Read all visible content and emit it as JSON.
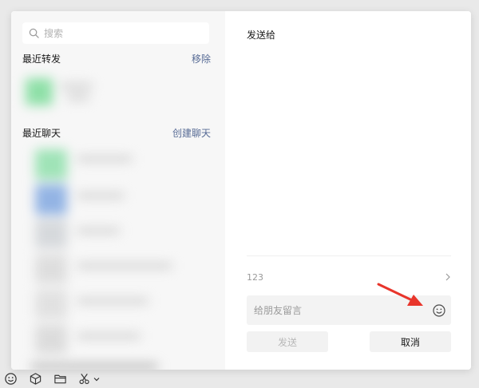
{
  "search": {
    "placeholder": "搜索"
  },
  "recent_forward": {
    "title": "最近转发",
    "action": "移除"
  },
  "recent_chats": {
    "title": "最近聊天",
    "action": "创建聊天"
  },
  "send_panel": {
    "title": "发送给",
    "preview_text": "123",
    "message_placeholder": "给朋友留言",
    "send_label": "发送",
    "cancel_label": "取消"
  },
  "colors": {
    "link": "#576b95",
    "accent_arrow": "#e8352b"
  },
  "toolbar_icons": [
    "smiley-icon",
    "cube-icon",
    "folder-icon",
    "scissors-icon",
    "chevron-down-icon"
  ]
}
